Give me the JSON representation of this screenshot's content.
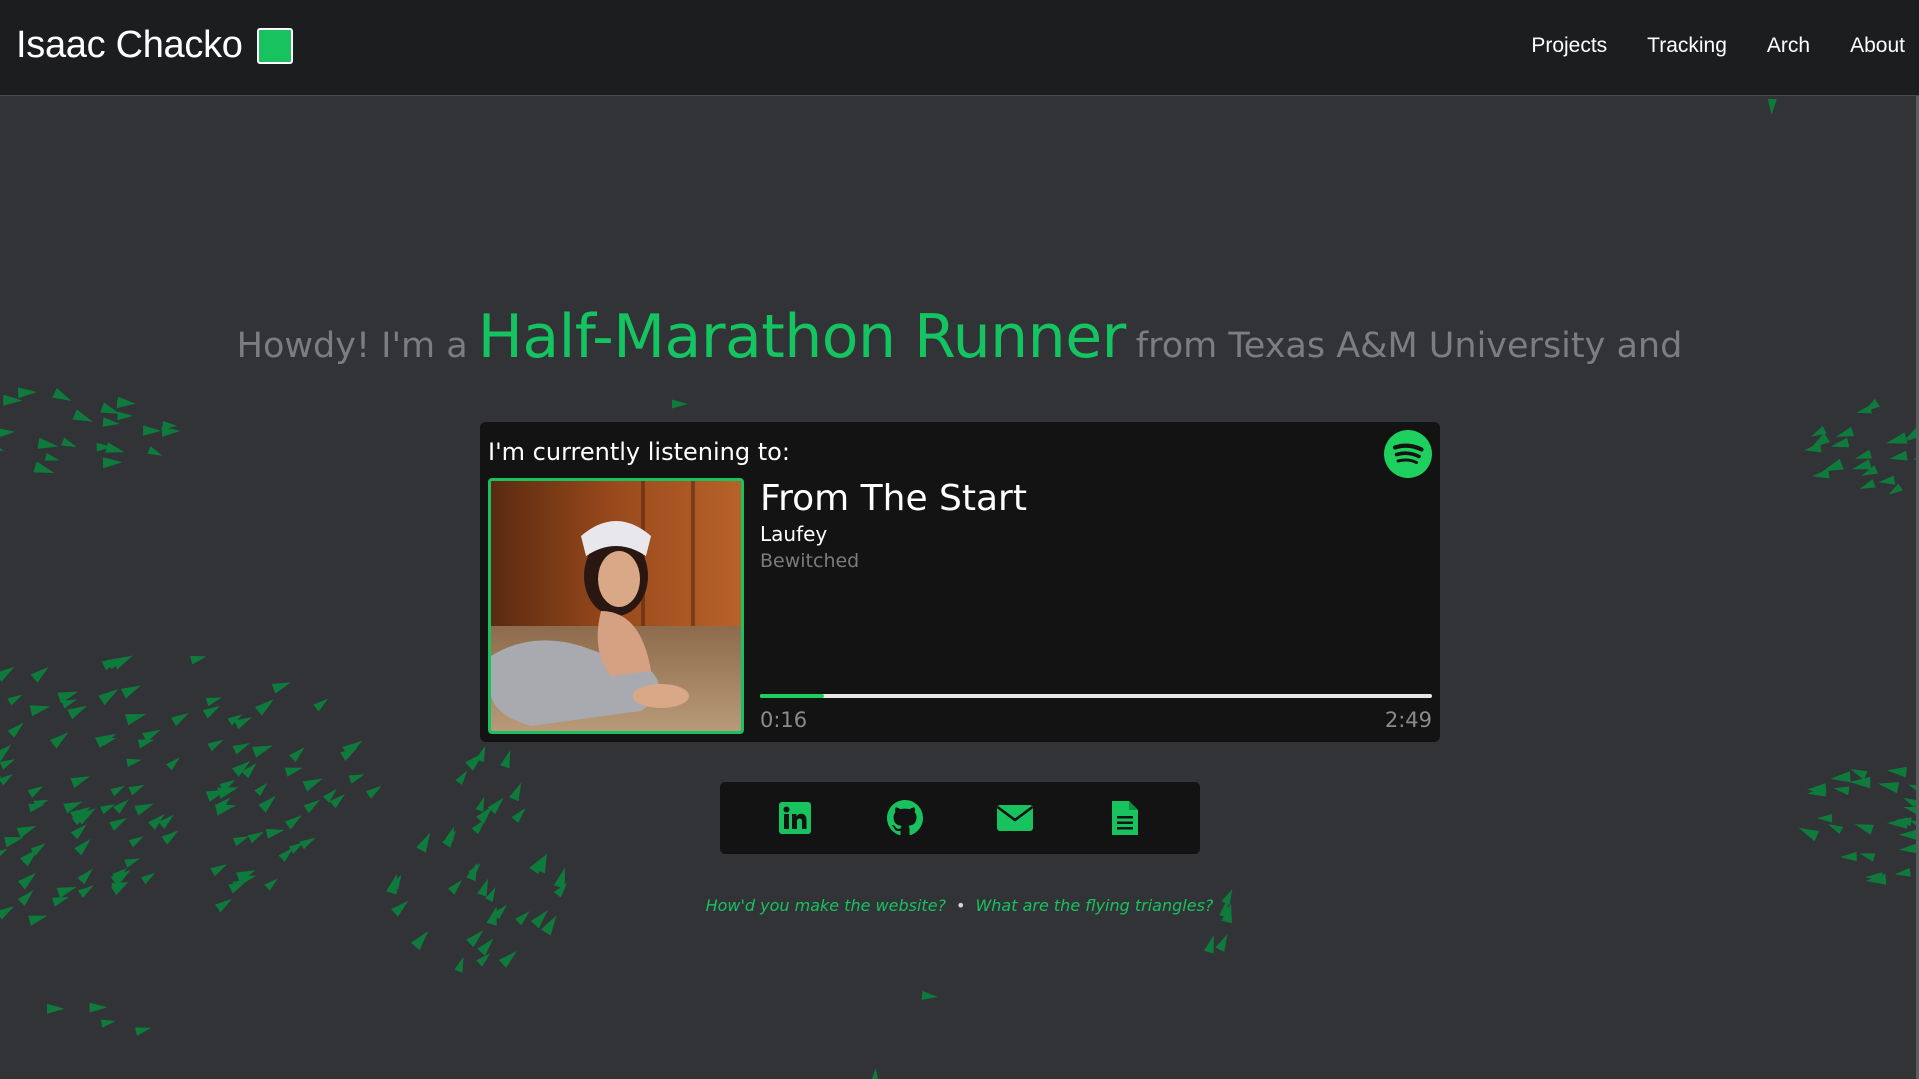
{
  "header": {
    "brand_name": "Isaac Chacko",
    "accent_color": "#17c25f",
    "nav": [
      {
        "label": "Projects"
      },
      {
        "label": "Tracking"
      },
      {
        "label": "Arch"
      },
      {
        "label": "About"
      }
    ]
  },
  "hero": {
    "prefix": "Howdy! I'm a",
    "role": "Half-Marathon Runner",
    "suffix": "from Texas A&M University and"
  },
  "now_playing": {
    "heading": "I'm currently listening to:",
    "service_icon": "spotify-icon",
    "track_title": "From The Start",
    "artist": "Laufey",
    "album": "Bewitched",
    "elapsed": "0:16",
    "duration": "2:49",
    "progress_fraction": 0.095
  },
  "social": [
    {
      "icon": "linkedin-icon"
    },
    {
      "icon": "github-icon"
    },
    {
      "icon": "email-icon"
    },
    {
      "icon": "resume-document-icon"
    }
  ],
  "footer": {
    "links": [
      {
        "label": "How'd you make the website?"
      },
      {
        "label": "What are the flying triangles?"
      }
    ],
    "separator": "•"
  }
}
